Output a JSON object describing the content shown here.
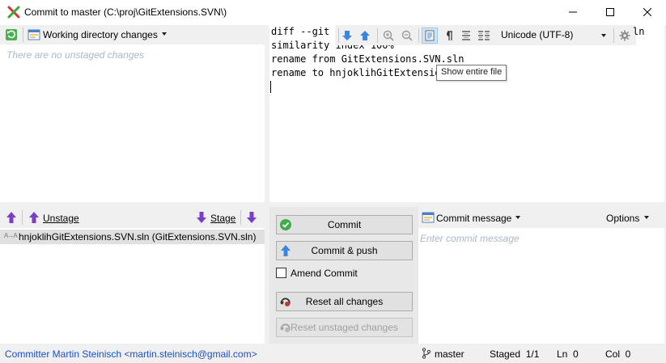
{
  "window": {
    "title": "Commit to master (C:\\proj\\GitExtensions.SVN\\)",
    "controls": {
      "minimize": "minimize",
      "maximize": "maximize",
      "close": "close"
    }
  },
  "unstaged": {
    "view_label": "Working directory changes",
    "empty_text": "There are no unstaged changes"
  },
  "diff": {
    "lines": [
      "diff --git",
      "similarity index 100%",
      "rename from GitExtensions.SVN.sln",
      "rename to hnjoklihGitExtensio"
    ],
    "trailing": "ln",
    "encoding": "Unicode (UTF-8)",
    "tooltip": "Show entire file"
  },
  "staged": {
    "unstage_label": "Unstage",
    "stage_label": "Stage",
    "files": [
      {
        "name": "hnjoklihGitExtensions.SVN.sln (GitExtensions.SVN.sln)"
      }
    ]
  },
  "actions": {
    "commit": "Commit",
    "commit_push": "Commit & push",
    "amend": "Amend Commit",
    "reset_all": "Reset all changes",
    "reset_unstaged": "Reset unstaged changes"
  },
  "message": {
    "label": "Commit message",
    "options": "Options",
    "placeholder": "Enter commit message"
  },
  "status": {
    "committer": "Committer Martin Steinisch <martin.steinisch@gmail.com>",
    "branch": "master",
    "staged": "Staged  1/1",
    "ln": "Ln  0",
    "col": "Col  0"
  },
  "colors": {
    "accent": "#1a4fd0",
    "placeholder": "#aab8cc",
    "arrow_purple": "#7a3fc8",
    "arrow_blue": "#3a86e0"
  }
}
